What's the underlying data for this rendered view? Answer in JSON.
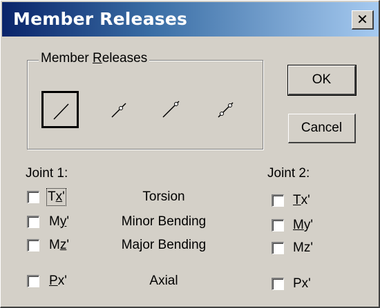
{
  "window": {
    "title": "Member Releases",
    "close_glyph": "✕"
  },
  "group": {
    "legend_pre": "Member ",
    "legend_u": "R",
    "legend_post": "eleases",
    "options": [
      {
        "name": "no-release",
        "selected": true
      },
      {
        "name": "release-start",
        "selected": false
      },
      {
        "name": "release-end",
        "selected": false
      },
      {
        "name": "release-both",
        "selected": false
      }
    ]
  },
  "buttons": {
    "ok": "OK",
    "cancel": "Cancel"
  },
  "joint1": {
    "title": "Joint 1:",
    "tx": {
      "pre": "T",
      "u": "x",
      "post": "'"
    },
    "my": {
      "pre": "M",
      "u": "y",
      "post": "'"
    },
    "mz": {
      "pre": "M",
      "u": "z",
      "post": "'"
    },
    "px": {
      "pre": "",
      "u": "P",
      "post": "x'"
    }
  },
  "joint2": {
    "title": "Joint 2:",
    "tx": {
      "pre": "",
      "u": "T",
      "post": "x'"
    },
    "my": {
      "pre": "",
      "u": "M",
      "post": "y'"
    },
    "mz": {
      "pre": "",
      "u": "",
      "post": "Mz'"
    },
    "px": {
      "pre": "",
      "u": "",
      "post": "Px'"
    }
  },
  "labels": {
    "torsion": "Torsion",
    "minor": "Minor Bending",
    "major": "Major Bending",
    "axial": "Axial"
  },
  "colors": {
    "title_start": "#0a246a",
    "title_end": "#a6caf0",
    "face": "#d4d0c8"
  }
}
